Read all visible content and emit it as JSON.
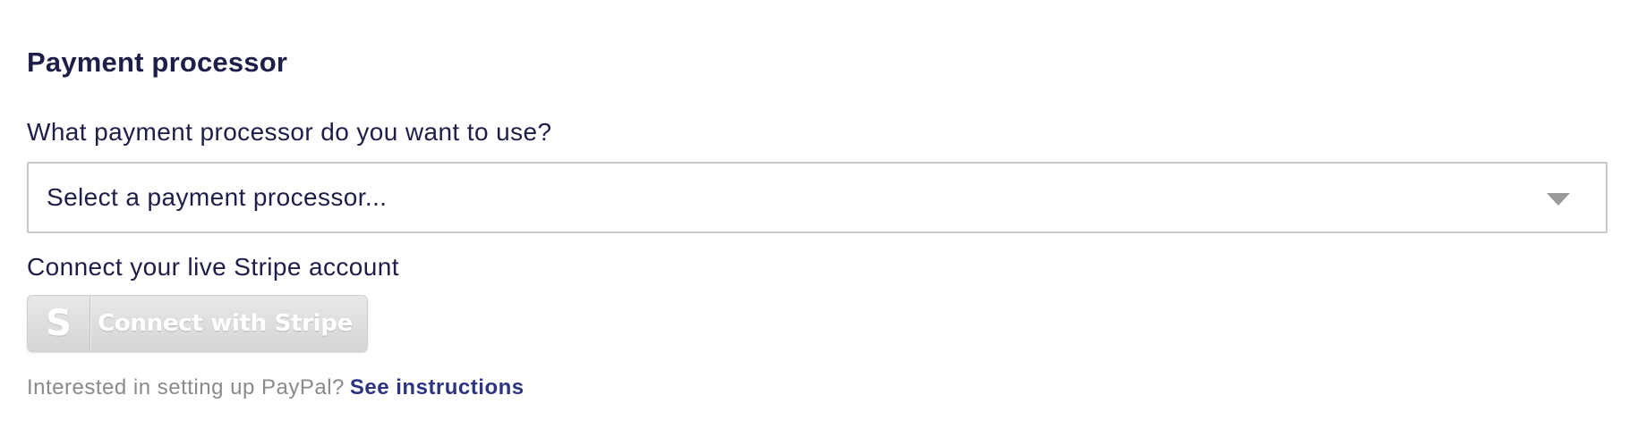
{
  "section": {
    "title": "Payment processor"
  },
  "processor_field": {
    "label": "What payment processor do you want to use?",
    "selected_value": "Select a payment processor..."
  },
  "stripe": {
    "label": "Connect your live Stripe account",
    "icon_letter": "S",
    "button_label": "Connect with Stripe",
    "icon": "stripe-s-icon"
  },
  "paypal": {
    "text": "Interested in setting up PayPal?",
    "link_label": "See instructions"
  },
  "colors": {
    "text_dark": "#1e1e48",
    "text_muted": "#8a8a8a",
    "link": "#2d3582",
    "border": "#c9c9c9",
    "disabled_button": "#d9d9d9"
  }
}
